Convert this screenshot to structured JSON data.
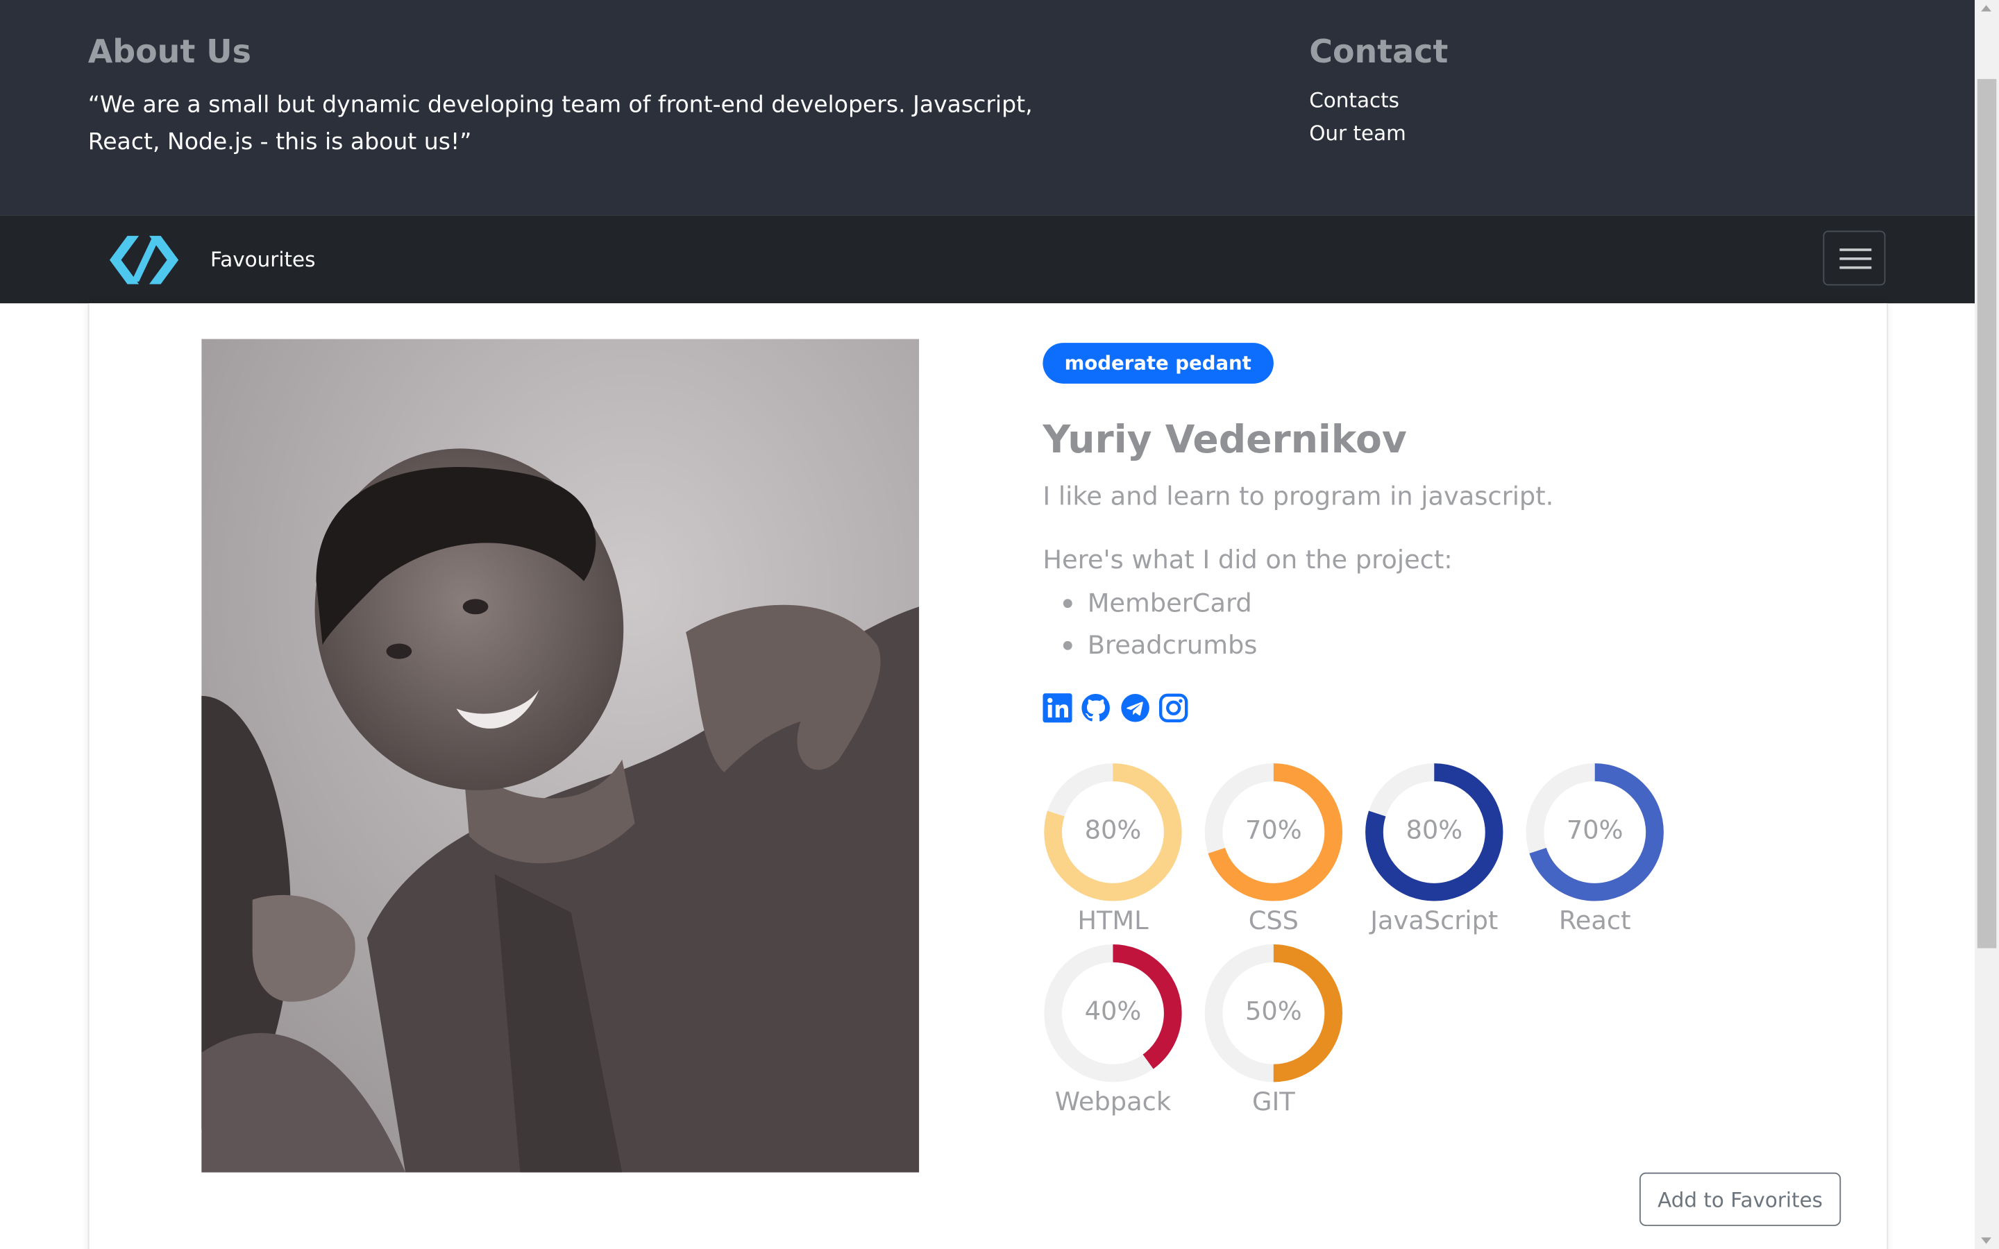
{
  "about": {
    "title": "About Us",
    "text": "“We are a small but dynamic developing team of front-end developers. Javascript, React, Node.js - this is about us!”"
  },
  "contact": {
    "title": "Contact",
    "links": [
      "Contacts",
      "Our team"
    ]
  },
  "navbar": {
    "logo_icon": "code-slash-logo-icon",
    "favourites_label": "Favourites",
    "toggler_icon": "hamburger-icon"
  },
  "member": {
    "badge": "moderate pedant",
    "name": "Yuriy Vedernikov",
    "tagline": "I like and learn to program in javascript.",
    "project_intro": "Here's what I did on the project:",
    "projects": [
      "MemberCard",
      "Breadcrumbs"
    ],
    "social_icons": [
      "linkedin-icon",
      "github-icon",
      "telegram-icon",
      "instagram-icon"
    ],
    "skills": [
      {
        "name": "HTML",
        "percent_label": "80%",
        "percent": 80,
        "color": "#fbd48a"
      },
      {
        "name": "CSS",
        "percent_label": "70%",
        "percent": 70,
        "color": "#fd9e3c"
      },
      {
        "name": "JavaScript",
        "percent_label": "80%",
        "percent": 80,
        "color": "#1f3a9a"
      },
      {
        "name": "React",
        "percent_label": "70%",
        "percent": 70,
        "color": "#4565c4"
      },
      {
        "name": "Webpack",
        "percent_label": "40%",
        "percent": 40,
        "color": "#c0143c"
      },
      {
        "name": "GIT",
        "percent_label": "50%",
        "percent": 50,
        "color": "#e88d1f"
      }
    ],
    "add_favorites_label": "Add to Favorites"
  },
  "colors": {
    "info_band": "#2b303b",
    "navbar": "#212529",
    "badge": "#0d6efd",
    "social": "#0d6efd",
    "logo": "#4fc8f0"
  }
}
